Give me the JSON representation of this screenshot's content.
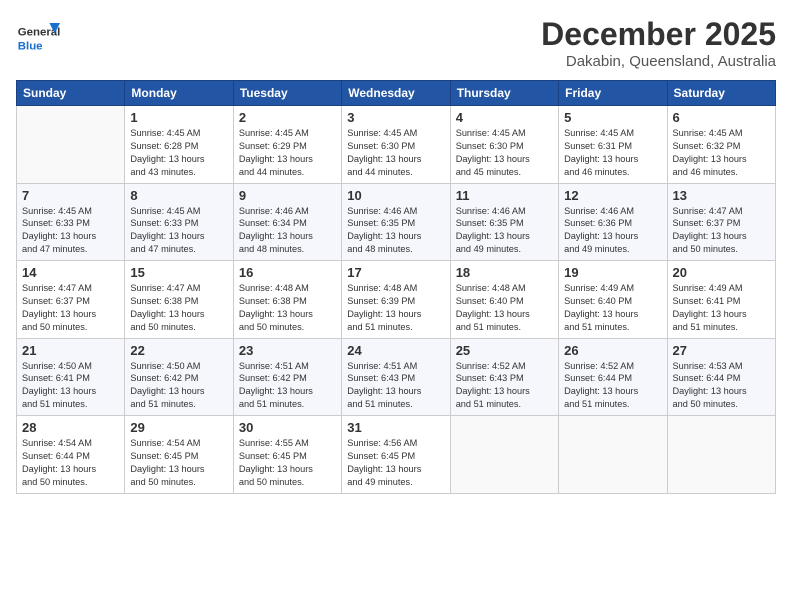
{
  "header": {
    "logo_general": "General",
    "logo_blue": "Blue",
    "month_title": "December 2025",
    "location": "Dakabin, Queensland, Australia"
  },
  "weekdays": [
    "Sunday",
    "Monday",
    "Tuesday",
    "Wednesday",
    "Thursday",
    "Friday",
    "Saturday"
  ],
  "weeks": [
    [
      {
        "day": "",
        "info": ""
      },
      {
        "day": "1",
        "info": "Sunrise: 4:45 AM\nSunset: 6:28 PM\nDaylight: 13 hours\nand 43 minutes."
      },
      {
        "day": "2",
        "info": "Sunrise: 4:45 AM\nSunset: 6:29 PM\nDaylight: 13 hours\nand 44 minutes."
      },
      {
        "day": "3",
        "info": "Sunrise: 4:45 AM\nSunset: 6:30 PM\nDaylight: 13 hours\nand 44 minutes."
      },
      {
        "day": "4",
        "info": "Sunrise: 4:45 AM\nSunset: 6:30 PM\nDaylight: 13 hours\nand 45 minutes."
      },
      {
        "day": "5",
        "info": "Sunrise: 4:45 AM\nSunset: 6:31 PM\nDaylight: 13 hours\nand 46 minutes."
      },
      {
        "day": "6",
        "info": "Sunrise: 4:45 AM\nSunset: 6:32 PM\nDaylight: 13 hours\nand 46 minutes."
      }
    ],
    [
      {
        "day": "7",
        "info": "Sunrise: 4:45 AM\nSunset: 6:33 PM\nDaylight: 13 hours\nand 47 minutes."
      },
      {
        "day": "8",
        "info": "Sunrise: 4:45 AM\nSunset: 6:33 PM\nDaylight: 13 hours\nand 47 minutes."
      },
      {
        "day": "9",
        "info": "Sunrise: 4:46 AM\nSunset: 6:34 PM\nDaylight: 13 hours\nand 48 minutes."
      },
      {
        "day": "10",
        "info": "Sunrise: 4:46 AM\nSunset: 6:35 PM\nDaylight: 13 hours\nand 48 minutes."
      },
      {
        "day": "11",
        "info": "Sunrise: 4:46 AM\nSunset: 6:35 PM\nDaylight: 13 hours\nand 49 minutes."
      },
      {
        "day": "12",
        "info": "Sunrise: 4:46 AM\nSunset: 6:36 PM\nDaylight: 13 hours\nand 49 minutes."
      },
      {
        "day": "13",
        "info": "Sunrise: 4:47 AM\nSunset: 6:37 PM\nDaylight: 13 hours\nand 50 minutes."
      }
    ],
    [
      {
        "day": "14",
        "info": "Sunrise: 4:47 AM\nSunset: 6:37 PM\nDaylight: 13 hours\nand 50 minutes."
      },
      {
        "day": "15",
        "info": "Sunrise: 4:47 AM\nSunset: 6:38 PM\nDaylight: 13 hours\nand 50 minutes."
      },
      {
        "day": "16",
        "info": "Sunrise: 4:48 AM\nSunset: 6:38 PM\nDaylight: 13 hours\nand 50 minutes."
      },
      {
        "day": "17",
        "info": "Sunrise: 4:48 AM\nSunset: 6:39 PM\nDaylight: 13 hours\nand 51 minutes."
      },
      {
        "day": "18",
        "info": "Sunrise: 4:48 AM\nSunset: 6:40 PM\nDaylight: 13 hours\nand 51 minutes."
      },
      {
        "day": "19",
        "info": "Sunrise: 4:49 AM\nSunset: 6:40 PM\nDaylight: 13 hours\nand 51 minutes."
      },
      {
        "day": "20",
        "info": "Sunrise: 4:49 AM\nSunset: 6:41 PM\nDaylight: 13 hours\nand 51 minutes."
      }
    ],
    [
      {
        "day": "21",
        "info": "Sunrise: 4:50 AM\nSunset: 6:41 PM\nDaylight: 13 hours\nand 51 minutes."
      },
      {
        "day": "22",
        "info": "Sunrise: 4:50 AM\nSunset: 6:42 PM\nDaylight: 13 hours\nand 51 minutes."
      },
      {
        "day": "23",
        "info": "Sunrise: 4:51 AM\nSunset: 6:42 PM\nDaylight: 13 hours\nand 51 minutes."
      },
      {
        "day": "24",
        "info": "Sunrise: 4:51 AM\nSunset: 6:43 PM\nDaylight: 13 hours\nand 51 minutes."
      },
      {
        "day": "25",
        "info": "Sunrise: 4:52 AM\nSunset: 6:43 PM\nDaylight: 13 hours\nand 51 minutes."
      },
      {
        "day": "26",
        "info": "Sunrise: 4:52 AM\nSunset: 6:44 PM\nDaylight: 13 hours\nand 51 minutes."
      },
      {
        "day": "27",
        "info": "Sunrise: 4:53 AM\nSunset: 6:44 PM\nDaylight: 13 hours\nand 50 minutes."
      }
    ],
    [
      {
        "day": "28",
        "info": "Sunrise: 4:54 AM\nSunset: 6:44 PM\nDaylight: 13 hours\nand 50 minutes."
      },
      {
        "day": "29",
        "info": "Sunrise: 4:54 AM\nSunset: 6:45 PM\nDaylight: 13 hours\nand 50 minutes."
      },
      {
        "day": "30",
        "info": "Sunrise: 4:55 AM\nSunset: 6:45 PM\nDaylight: 13 hours\nand 50 minutes."
      },
      {
        "day": "31",
        "info": "Sunrise: 4:56 AM\nSunset: 6:45 PM\nDaylight: 13 hours\nand 49 minutes."
      },
      {
        "day": "",
        "info": ""
      },
      {
        "day": "",
        "info": ""
      },
      {
        "day": "",
        "info": ""
      }
    ]
  ]
}
